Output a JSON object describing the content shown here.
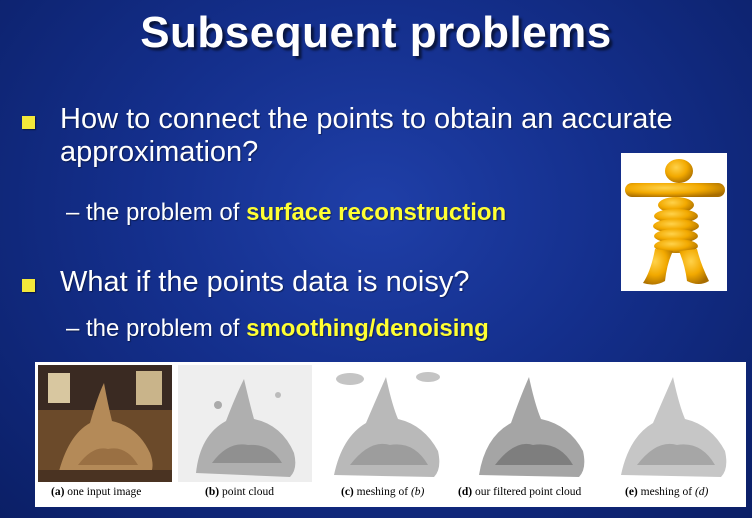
{
  "slide": {
    "title": "Subsequent problems",
    "bullets": [
      {
        "line1": "How to connect the points to obtain an accurate",
        "line2": "approximation?",
        "sub_prefix": "– the problem of ",
        "sub_highlight": "surface reconstruction"
      },
      {
        "line1": "What if the points data is noisy?",
        "sub_prefix": "– the problem of ",
        "sub_highlight": "smoothing/denoising"
      }
    ]
  },
  "colors": {
    "background": "#142f8c",
    "bullet_square": "#f3e83a",
    "highlight": "#ffff33",
    "figure_gold": "#f2a900"
  },
  "figure": {
    "icon": "inukshuk-figure-icon"
  },
  "strip": {
    "captions": [
      {
        "label": "(a)",
        "text": " one input image"
      },
      {
        "label": "(b)",
        "text": " point cloud"
      },
      {
        "label": "(c)",
        "text": " meshing of ",
        "ref": "(b)"
      },
      {
        "label": "(d)",
        "text": " our filtered point cloud"
      },
      {
        "label": "(e)",
        "text": " meshing of ",
        "ref": "(d)"
      }
    ]
  }
}
